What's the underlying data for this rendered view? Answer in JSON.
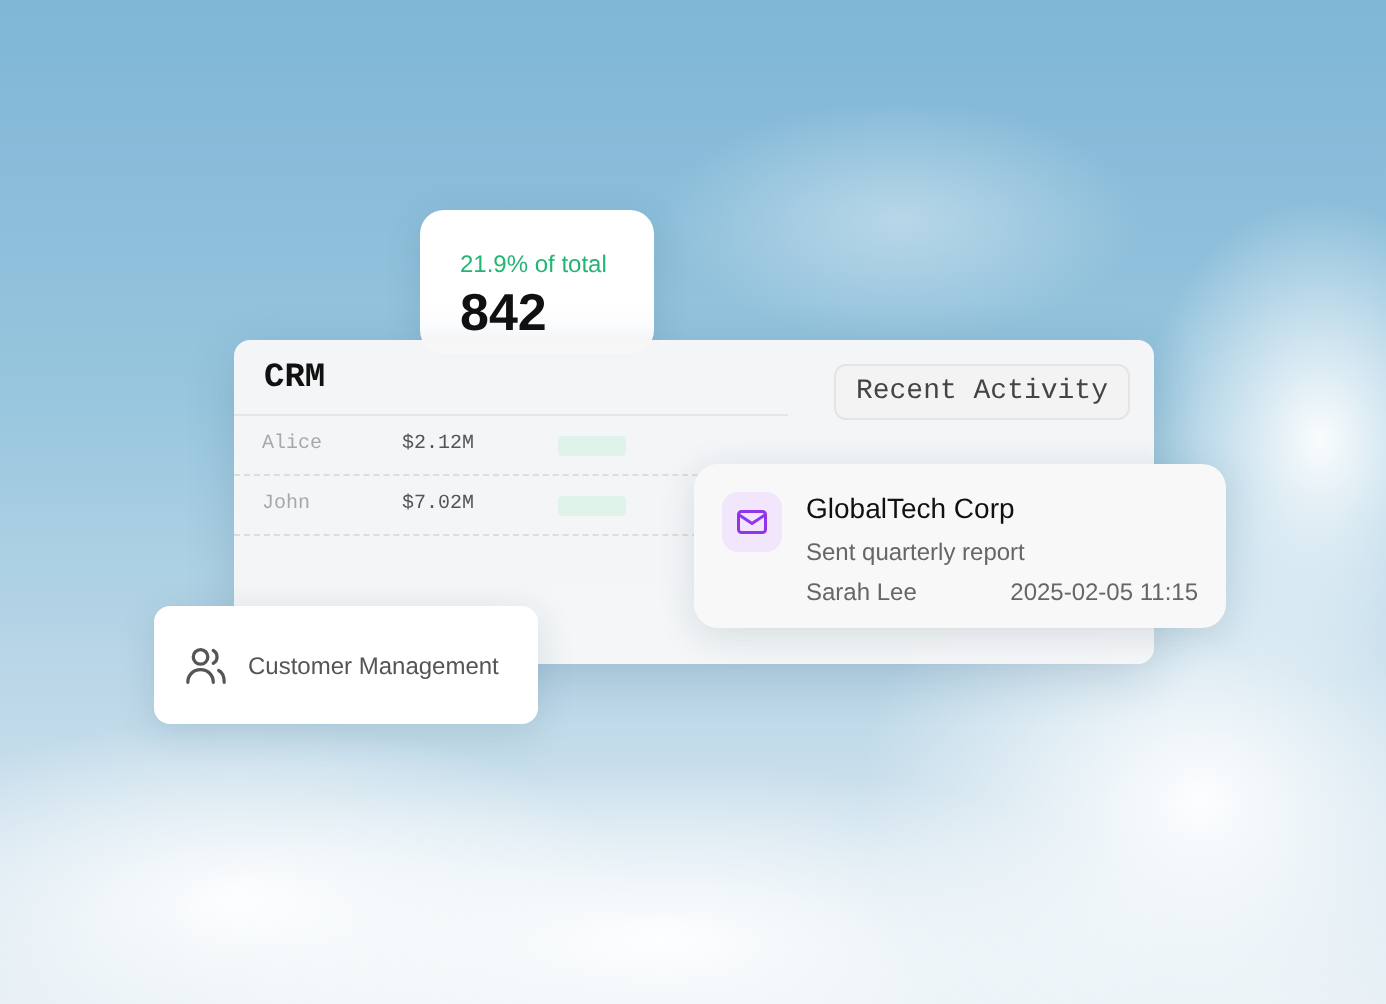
{
  "stat_card": {
    "caption": "21.9% of total",
    "value": "842"
  },
  "crm_panel": {
    "title": "CRM",
    "tab": "Recent Activity",
    "rows": [
      {
        "name": "Alice",
        "amount": "$2.12M"
      },
      {
        "name": "John",
        "amount": "$7.02M"
      }
    ]
  },
  "activity_card": {
    "company": "GlobalTech Corp",
    "action": "Sent quarterly report",
    "person": "Sarah Lee",
    "time": "2025-02-05 11:15"
  },
  "nav_card": {
    "label": "Customer Management"
  }
}
